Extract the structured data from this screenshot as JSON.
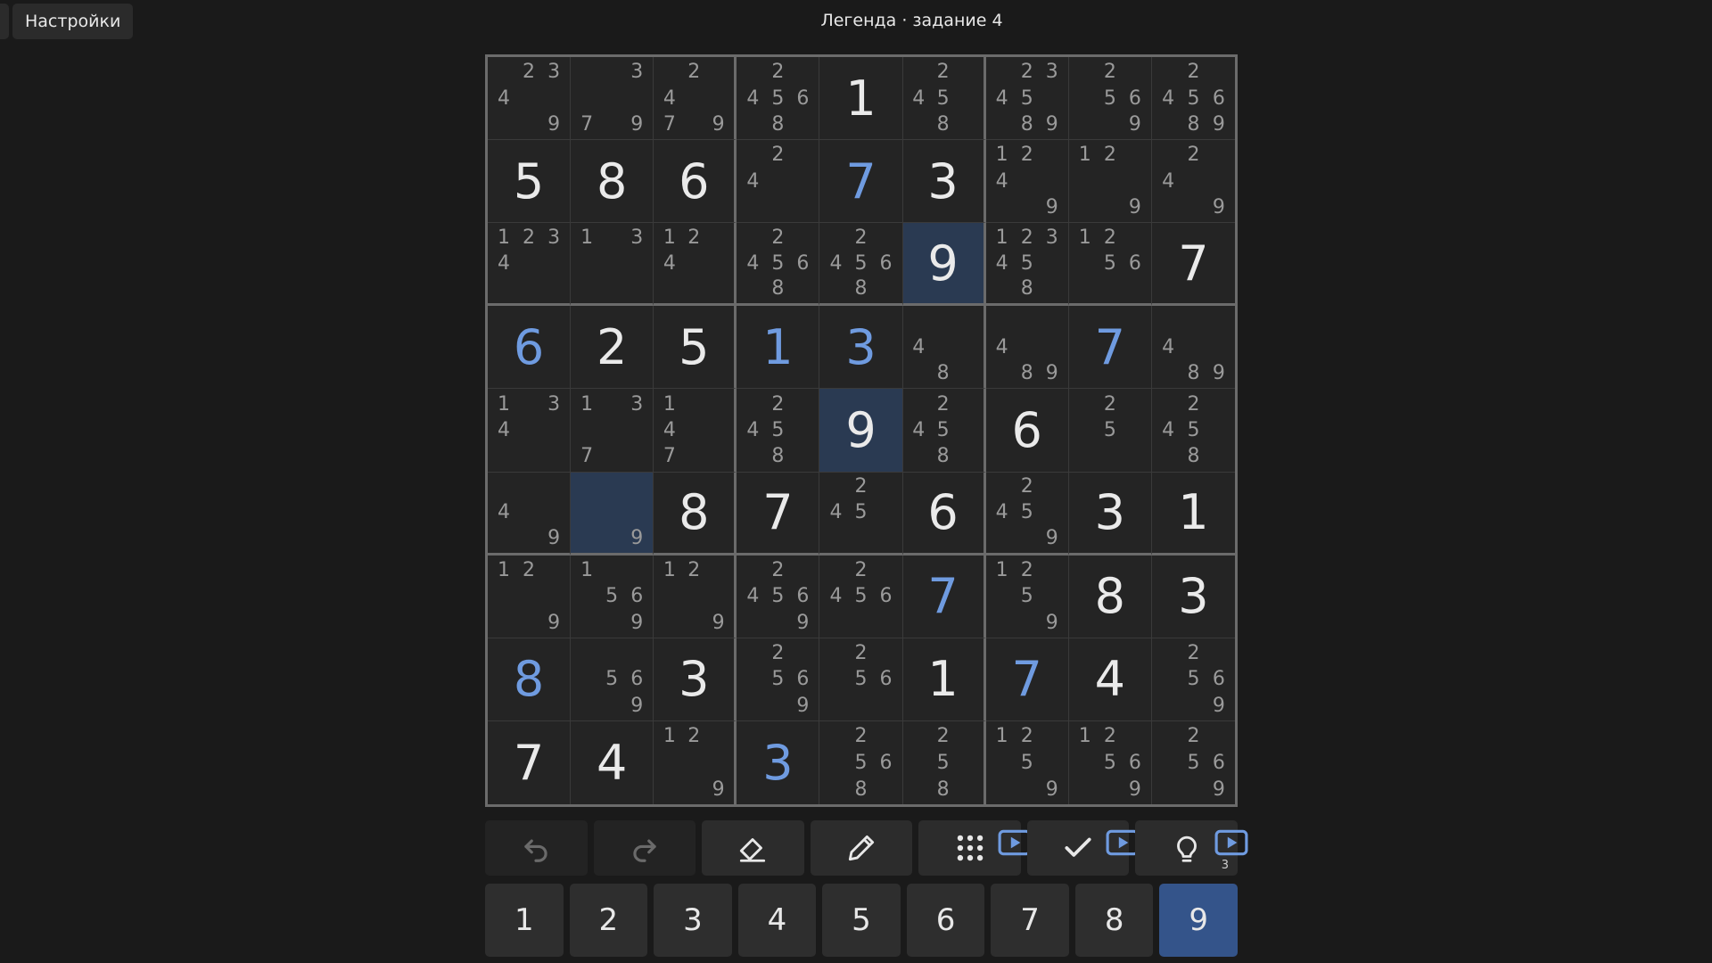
{
  "header": {
    "settings_label": "Настройки",
    "title": "Легенда · задание 4"
  },
  "colors": {
    "background": "#1a1a1a",
    "highlight": "#2a3a52",
    "user_digit": "#6f9be0",
    "given_digit": "#eaeaea",
    "notes": "#9a9a9a",
    "selected_number": "#34548a"
  },
  "board": {
    "highlighted_digit": "9",
    "cells": [
      [
        {
          "notes": [
            2,
            3,
            4,
            9
          ]
        },
        {
          "notes": [
            3,
            7,
            9
          ]
        },
        {
          "notes": [
            2,
            4,
            7,
            9
          ]
        },
        {
          "notes": [
            2,
            4,
            5,
            6,
            8
          ]
        },
        {
          "v": "1",
          "given": true
        },
        {
          "notes": [
            2,
            4,
            5,
            8
          ]
        },
        {
          "notes": [
            2,
            3,
            4,
            5,
            8,
            9
          ]
        },
        {
          "notes": [
            2,
            5,
            6,
            9
          ]
        },
        {
          "notes": [
            2,
            4,
            5,
            6,
            8,
            9
          ]
        }
      ],
      [
        {
          "v": "5",
          "given": true
        },
        {
          "v": "8",
          "given": true
        },
        {
          "v": "6",
          "given": true
        },
        {
          "notes": [
            2,
            4
          ]
        },
        {
          "v": "7",
          "given": false
        },
        {
          "v": "3",
          "given": true
        },
        {
          "notes": [
            1,
            2,
            4,
            9
          ]
        },
        {
          "notes": [
            1,
            2,
            9
          ]
        },
        {
          "notes": [
            2,
            4,
            9
          ]
        }
      ],
      [
        {
          "notes": [
            1,
            2,
            3,
            4
          ]
        },
        {
          "notes": [
            1,
            3
          ]
        },
        {
          "notes": [
            1,
            2,
            4
          ]
        },
        {
          "notes": [
            2,
            4,
            5,
            6,
            8
          ]
        },
        {
          "notes": [
            2,
            4,
            5,
            6,
            8
          ]
        },
        {
          "v": "9",
          "given": true,
          "hl": true
        },
        {
          "notes": [
            1,
            2,
            3,
            4,
            5,
            8
          ]
        },
        {
          "notes": [
            1,
            2,
            5,
            6
          ]
        },
        {
          "v": "7",
          "given": true
        }
      ],
      [
        {
          "v": "6",
          "given": false
        },
        {
          "v": "2",
          "given": true
        },
        {
          "v": "5",
          "given": true
        },
        {
          "v": "1",
          "given": false
        },
        {
          "v": "3",
          "given": false
        },
        {
          "notes": [
            4,
            8
          ]
        },
        {
          "notes": [
            4,
            8,
            9
          ]
        },
        {
          "v": "7",
          "given": false
        },
        {
          "notes": [
            4,
            8,
            9
          ]
        }
      ],
      [
        {
          "notes": [
            1,
            3,
            4
          ]
        },
        {
          "notes": [
            1,
            3,
            7
          ]
        },
        {
          "notes": [
            1,
            4,
            7
          ]
        },
        {
          "notes": [
            2,
            4,
            5,
            8
          ]
        },
        {
          "v": "9",
          "given": true,
          "hl": true
        },
        {
          "notes": [
            2,
            4,
            5,
            8
          ]
        },
        {
          "v": "6",
          "given": true
        },
        {
          "notes": [
            2,
            5
          ]
        },
        {
          "notes": [
            2,
            4,
            5,
            8
          ]
        }
      ],
      [
        {
          "notes": [
            4,
            9
          ]
        },
        {
          "notes": [
            9
          ],
          "hl": true
        },
        {
          "v": "8",
          "given": true
        },
        {
          "v": "7",
          "given": true
        },
        {
          "notes": [
            2,
            4,
            5
          ]
        },
        {
          "v": "6",
          "given": true
        },
        {
          "notes": [
            2,
            4,
            5,
            9
          ]
        },
        {
          "v": "3",
          "given": true
        },
        {
          "v": "1",
          "given": true
        }
      ],
      [
        {
          "notes": [
            1,
            2,
            9
          ]
        },
        {
          "notes": [
            1,
            5,
            6,
            9
          ]
        },
        {
          "notes": [
            1,
            2,
            9
          ]
        },
        {
          "notes": [
            2,
            4,
            5,
            6,
            9
          ]
        },
        {
          "notes": [
            2,
            4,
            5,
            6
          ]
        },
        {
          "v": "7",
          "given": false
        },
        {
          "notes": [
            1,
            2,
            5,
            9
          ]
        },
        {
          "v": "8",
          "given": true
        },
        {
          "v": "3",
          "given": true
        }
      ],
      [
        {
          "v": "8",
          "given": false
        },
        {
          "notes": [
            5,
            6,
            9
          ]
        },
        {
          "v": "3",
          "given": true
        },
        {
          "notes": [
            2,
            5,
            6,
            9
          ]
        },
        {
          "notes": [
            2,
            5,
            6
          ]
        },
        {
          "v": "1",
          "given": true
        },
        {
          "v": "7",
          "given": false
        },
        {
          "v": "4",
          "given": true
        },
        {
          "notes": [
            2,
            5,
            6,
            9
          ]
        }
      ],
      [
        {
          "v": "7",
          "given": true
        },
        {
          "v": "4",
          "given": true
        },
        {
          "notes": [
            1,
            2,
            9
          ]
        },
        {
          "v": "3",
          "given": false
        },
        {
          "notes": [
            2,
            5,
            6,
            8
          ]
        },
        {
          "notes": [
            2,
            5,
            8
          ]
        },
        {
          "notes": [
            1,
            2,
            5,
            9
          ]
        },
        {
          "notes": [
            1,
            2,
            5,
            6,
            9
          ]
        },
        {
          "notes": [
            2,
            5,
            6,
            9
          ]
        }
      ]
    ]
  },
  "toolbar": {
    "tools": [
      {
        "name": "undo-button",
        "icon": "undo-icon",
        "enabled": false
      },
      {
        "name": "redo-button",
        "icon": "redo-icon",
        "enabled": false
      },
      {
        "name": "erase-button",
        "icon": "eraser-icon",
        "enabled": true
      },
      {
        "name": "notes-button",
        "icon": "pencil-icon",
        "enabled": true
      },
      {
        "name": "auto-notes-button",
        "icon": "grid-dots-icon",
        "enabled": true,
        "ad": true
      },
      {
        "name": "check-button",
        "icon": "check-icon",
        "enabled": true,
        "ad": true
      },
      {
        "name": "hint-button",
        "icon": "lightbulb-icon",
        "enabled": true,
        "ad": true,
        "count": "3"
      }
    ]
  },
  "numpad": {
    "keys": [
      "1",
      "2",
      "3",
      "4",
      "5",
      "6",
      "7",
      "8",
      "9"
    ],
    "selected": "9"
  }
}
